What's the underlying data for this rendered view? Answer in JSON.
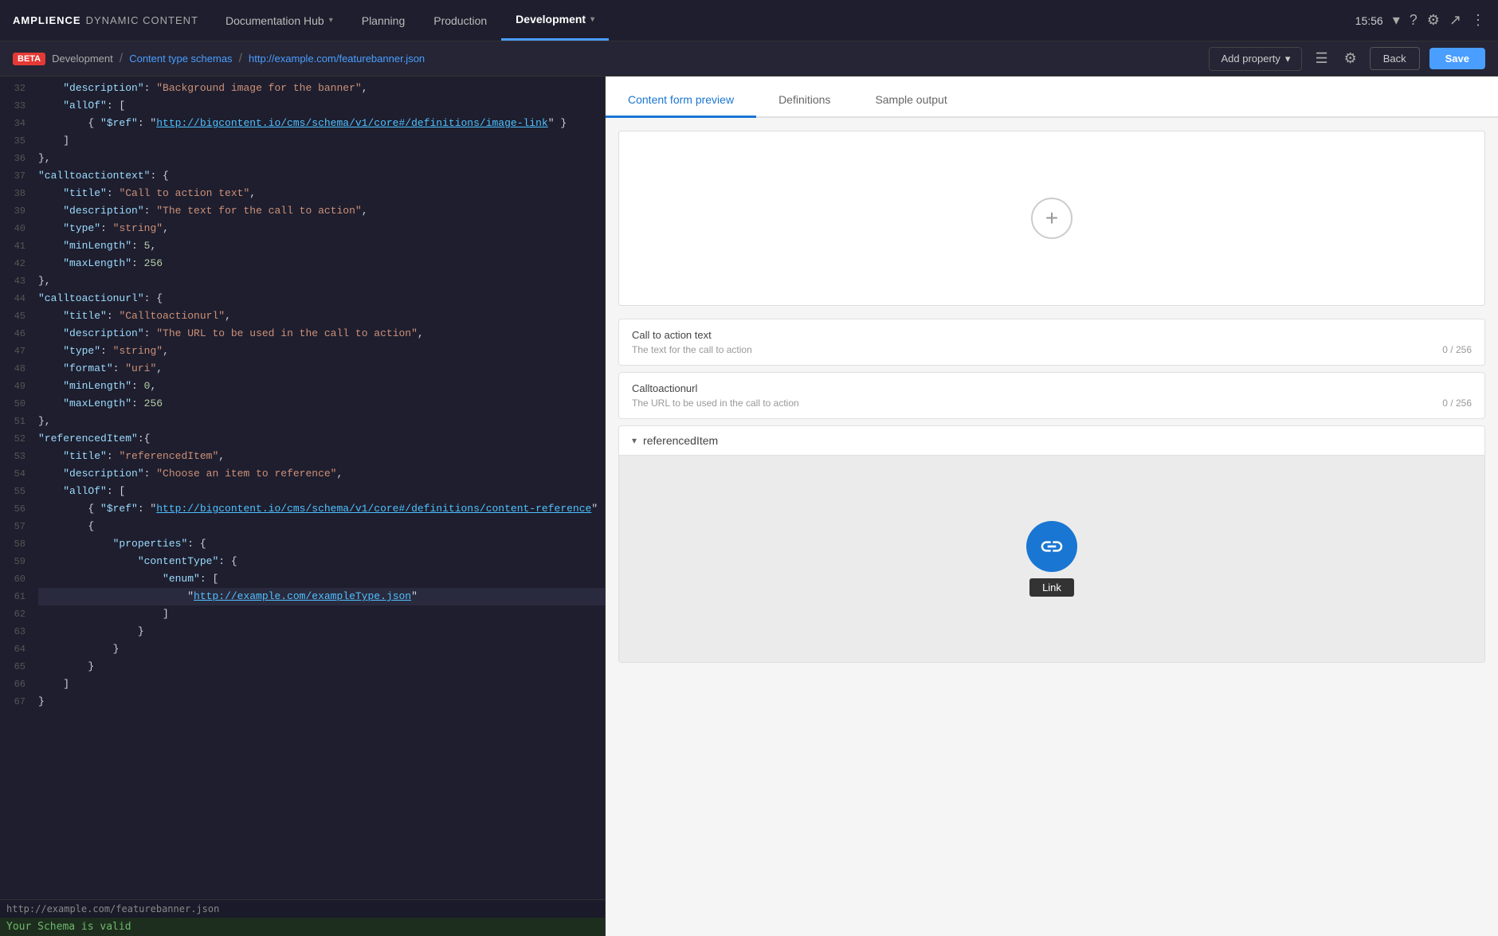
{
  "brand": {
    "amplience": "AMPLIENCE",
    "dynamic": "DYNAMIC CONTENT"
  },
  "nav": {
    "items": [
      {
        "label": "Documentation Hub",
        "caret": true,
        "active": false
      },
      {
        "label": "Planning",
        "caret": false,
        "active": false
      },
      {
        "label": "Production",
        "caret": false,
        "active": false
      },
      {
        "label": "Development",
        "caret": true,
        "active": true
      }
    ],
    "time": "15:56",
    "time_caret": true
  },
  "breadcrumb": {
    "beta": "BETA",
    "development": "Development",
    "sep1": "/",
    "content_type": "Content type schemas",
    "sep2": "/",
    "url": "http://example.com/featurebanner.json"
  },
  "toolbar": {
    "add_property": "Add property",
    "back": "Back",
    "save": "Save"
  },
  "tabs": {
    "items": [
      {
        "label": "Content form preview",
        "active": true
      },
      {
        "label": "Definitions",
        "active": false
      },
      {
        "label": "Sample output",
        "active": false
      }
    ]
  },
  "code_lines": [
    {
      "num": 32,
      "content": "    \"description\": \"Background image for the banner\","
    },
    {
      "num": 33,
      "content": "    \"allOf\": ["
    },
    {
      "num": 34,
      "content": "        { \"$ref\": \"http://bigcontent.io/cms/schema/v1/core#/definitions/image-link\" }"
    },
    {
      "num": 35,
      "content": "    ]"
    },
    {
      "num": 36,
      "content": "},"
    },
    {
      "num": 37,
      "content": "\"calltoactiontext\": {"
    },
    {
      "num": 38,
      "content": "    \"title\": \"Call to action text\","
    },
    {
      "num": 39,
      "content": "    \"description\": \"The text for the call to action\","
    },
    {
      "num": 40,
      "content": "    \"type\": \"string\","
    },
    {
      "num": 41,
      "content": "    \"minLength\": 5,"
    },
    {
      "num": 42,
      "content": "    \"maxLength\": 256"
    },
    {
      "num": 43,
      "content": "},"
    },
    {
      "num": 44,
      "content": "\"calltoactionurl\": {"
    },
    {
      "num": 45,
      "content": "    \"title\": \"Calltoactionurl\","
    },
    {
      "num": 46,
      "content": "    \"description\": \"The URL to be used in the call to action\","
    },
    {
      "num": 47,
      "content": "    \"type\": \"string\","
    },
    {
      "num": 48,
      "content": "    \"format\": \"uri\","
    },
    {
      "num": 49,
      "content": "    \"minLength\": 0,"
    },
    {
      "num": 50,
      "content": "    \"maxLength\": 256"
    },
    {
      "num": 51,
      "content": "},"
    },
    {
      "num": 52,
      "content": "\"referencedItem\":{"
    },
    {
      "num": 53,
      "content": "    \"title\": \"referencedItem\","
    },
    {
      "num": 54,
      "content": "    \"description\": \"Choose an item to reference\","
    },
    {
      "num": 55,
      "content": "    \"allOf\": ["
    },
    {
      "num": 56,
      "content": "        { \"$ref\": \"http://bigcontent.io/cms/schema/v1/core#/definitions/content-reference\" }"
    },
    {
      "num": 57,
      "content": "        {"
    },
    {
      "num": 58,
      "content": "            \"properties\": {"
    },
    {
      "num": 59,
      "content": "                \"contentType\": {"
    },
    {
      "num": 60,
      "content": "                    \"enum\": ["
    },
    {
      "num": 61,
      "content": "                        \"http://example.com/exampleType.json\"",
      "highlighted": true
    },
    {
      "num": 62,
      "content": "                    ]"
    },
    {
      "num": 63,
      "content": "                }"
    },
    {
      "num": 64,
      "content": "            }"
    },
    {
      "num": 65,
      "content": "        }"
    },
    {
      "num": 66,
      "content": "    ]"
    },
    {
      "num": 67,
      "content": "}"
    }
  ],
  "status": {
    "url": "http://example.com/featurebanner.json",
    "valid": "Your Schema is valid"
  },
  "form_preview": {
    "call_to_action": {
      "label": "Call to action text",
      "hint": "The text for the call to action",
      "counter": "0 / 256"
    },
    "calltoactionurl": {
      "label": "Calltoactionurl",
      "hint": "The URL to be used in the call to action",
      "counter": "0 / 256"
    },
    "referenced_item": {
      "label": "referencedItem",
      "link_label": "Link"
    }
  }
}
